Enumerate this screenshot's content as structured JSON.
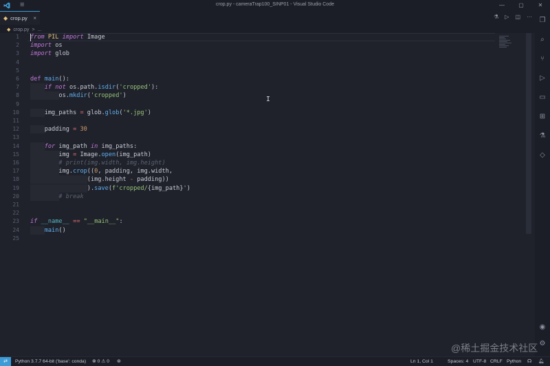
{
  "window": {
    "title": "crop.py - cameraTrap100_SINP01 - Visual Studio Code",
    "minimize": "—",
    "maximize": "▢",
    "close": "✕"
  },
  "tab": {
    "label": "crop.py",
    "icon": "python-file-icon",
    "close": "×"
  },
  "breadcrumb": {
    "file": "crop.py",
    "separator": ">",
    "symbol": "..."
  },
  "editor": {
    "line_numbers": [
      "1",
      "2",
      "3",
      "4",
      "5",
      "6",
      "7",
      "8",
      "9",
      "10",
      "11",
      "12",
      "13",
      "14",
      "15",
      "16",
      "17",
      "18",
      "19",
      "20",
      "21",
      "22",
      "23",
      "24",
      "25"
    ],
    "lines": [
      [
        [
          "kw",
          "from"
        ],
        [
          "t",
          " "
        ],
        [
          "mod",
          "PIL"
        ],
        [
          "t",
          " "
        ],
        [
          "kw",
          "import"
        ],
        [
          "t",
          " Image"
        ]
      ],
      [
        [
          "kw",
          "import"
        ],
        [
          "t",
          " os"
        ]
      ],
      [
        [
          "kw",
          "import"
        ],
        [
          "t",
          " glob"
        ]
      ],
      [],
      [],
      [
        [
          "kw2",
          "def"
        ],
        [
          "t",
          " "
        ],
        [
          "fn",
          "main"
        ],
        [
          "t",
          "():"
        ]
      ],
      [
        [
          "t",
          "    "
        ],
        [
          "kw",
          "if"
        ],
        [
          "t",
          " "
        ],
        [
          "kw",
          "not"
        ],
        [
          "t",
          " os.path."
        ],
        [
          "fn",
          "isdir"
        ],
        [
          "t",
          "("
        ],
        [
          "str",
          "'cropped'"
        ],
        [
          "t",
          "):"
        ]
      ],
      [
        [
          "t",
          "        os."
        ],
        [
          "fn",
          "mkdir"
        ],
        [
          "t",
          "("
        ],
        [
          "str",
          "'cropped'"
        ],
        [
          "t",
          ")"
        ]
      ],
      [],
      [
        [
          "t",
          "    img_paths "
        ],
        [
          "op",
          "="
        ],
        [
          "t",
          " glob."
        ],
        [
          "fn",
          "glob"
        ],
        [
          "t",
          "("
        ],
        [
          "str",
          "'*.jpg'"
        ],
        [
          "t",
          ")"
        ]
      ],
      [],
      [
        [
          "t",
          "    padding "
        ],
        [
          "op",
          "="
        ],
        [
          "t",
          " "
        ],
        [
          "num",
          "30"
        ]
      ],
      [],
      [
        [
          "t",
          "    "
        ],
        [
          "kw",
          "for"
        ],
        [
          "t",
          " img_path "
        ],
        [
          "kw",
          "in"
        ],
        [
          "t",
          " img_paths:"
        ]
      ],
      [
        [
          "t",
          "        img "
        ],
        [
          "op",
          "="
        ],
        [
          "t",
          " Image."
        ],
        [
          "fn",
          "open"
        ],
        [
          "t",
          "(img_path)"
        ]
      ],
      [
        [
          "t",
          "        "
        ],
        [
          "cm",
          "# print(img.width, img.height)"
        ]
      ],
      [
        [
          "t",
          "        img."
        ],
        [
          "fn",
          "crop"
        ],
        [
          "t",
          "(("
        ],
        [
          "num",
          "0"
        ],
        [
          "t",
          ", padding, img.width,"
        ]
      ],
      [
        [
          "t",
          "                (img.height "
        ],
        [
          "op",
          "-"
        ],
        [
          "t",
          " padding))"
        ]
      ],
      [
        [
          "t",
          "                )."
        ],
        [
          "fn",
          "save"
        ],
        [
          "t",
          "("
        ],
        [
          "str",
          "f'cropped/"
        ],
        [
          "t",
          "{img_path}"
        ],
        [
          "str",
          "'"
        ],
        [
          "t",
          ")"
        ]
      ],
      [
        [
          "t",
          "        "
        ],
        [
          "cm",
          "# break"
        ]
      ],
      [],
      [],
      [
        [
          "kw",
          "if"
        ],
        [
          "t",
          " "
        ],
        [
          "dunder",
          "__name__"
        ],
        [
          "t",
          " "
        ],
        [
          "op",
          "=="
        ],
        [
          "t",
          " "
        ],
        [
          "str",
          "\"__main__\""
        ],
        [
          "t",
          ":"
        ]
      ],
      [
        [
          "t",
          "    "
        ],
        [
          "fn",
          "main"
        ],
        [
          "t",
          "()"
        ]
      ],
      []
    ]
  },
  "activity_bar": [
    "files-icon",
    "search-icon",
    "source-control-icon",
    "run-debug-icon",
    "remote-explorer-icon",
    "extensions-icon",
    "testing-icon",
    "docker-icon",
    "account-icon",
    "settings-gear-icon"
  ],
  "editor_actions": [
    "run-icon",
    "play-icon",
    "split-editor-icon",
    "more-icon"
  ],
  "statusbar": {
    "interpreter": "Python 3.7.7 64-bit ('base': conda)",
    "problems": "⊗ 0 ⚠ 0",
    "position": "Ln 1, Col 1",
    "spaces": "Spaces: 4",
    "encoding": "UTF-8",
    "eol": "CRLF",
    "language": "Python"
  },
  "watermark": "@稀土掘金技术社区"
}
